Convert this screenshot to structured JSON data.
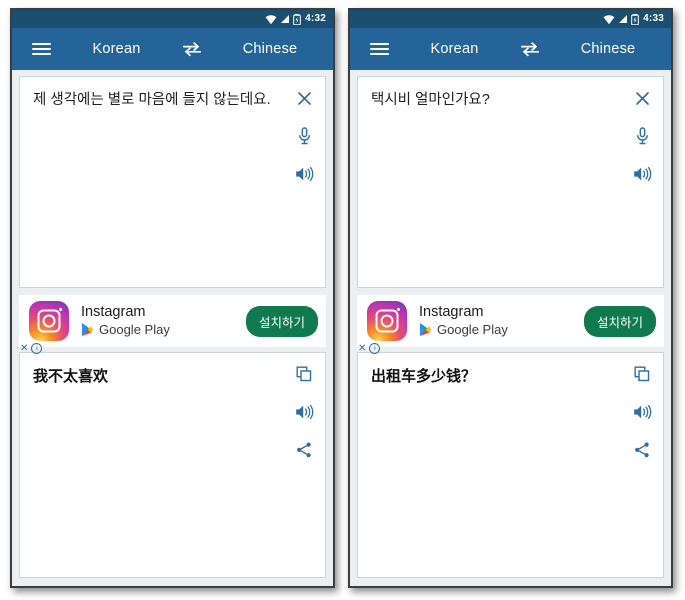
{
  "panels": [
    {
      "statusbar": {
        "time": "4:32",
        "wifi_icon": "wifi-icon",
        "signal_icon": "signal-icon",
        "battery_icon": "battery-charging-icon"
      },
      "appbar": {
        "menu_icon": "hamburger-menu-icon",
        "source_language": "Korean",
        "swap_icon": "swap-languages-icon",
        "target_language": "Chinese"
      },
      "input": {
        "text": "제 생각에는 별로 마음에 들지 않는데요.",
        "clear_icon": "close-icon",
        "mic_icon": "microphone-icon",
        "speak_icon": "speaker-icon"
      },
      "ad": {
        "app_name": "Instagram",
        "store": "Google Play",
        "store_icon": "google-play-icon",
        "app_icon": "instagram-icon",
        "install_label": "설치하기",
        "close_label": "✕",
        "info_label": "i"
      },
      "output": {
        "text": "我不太喜欢",
        "copy_icon": "copy-icon",
        "speak_icon": "speaker-icon",
        "share_icon": "share-icon"
      }
    },
    {
      "statusbar": {
        "time": "4:33",
        "wifi_icon": "wifi-icon",
        "signal_icon": "signal-icon",
        "battery_icon": "battery-charging-icon"
      },
      "appbar": {
        "menu_icon": "hamburger-menu-icon",
        "source_language": "Korean",
        "swap_icon": "swap-languages-icon",
        "target_language": "Chinese"
      },
      "input": {
        "text": "택시비 얼마인가요?",
        "clear_icon": "close-icon",
        "mic_icon": "microphone-icon",
        "speak_icon": "speaker-icon"
      },
      "ad": {
        "app_name": "Instagram",
        "store": "Google Play",
        "store_icon": "google-play-icon",
        "app_icon": "instagram-icon",
        "install_label": "설치하기",
        "close_label": "✕",
        "info_label": "i"
      },
      "output": {
        "text": "出租车多少钱？",
        "copy_icon": "copy-icon",
        "speak_icon": "speaker-icon",
        "share_icon": "share-icon"
      }
    }
  ],
  "colors": {
    "statusbar": "#1b4f72",
    "appbar": "#246499",
    "icon_blue": "#2f6da3",
    "install_green": "#0f7a4d",
    "screen_bg": "#eceff1"
  }
}
